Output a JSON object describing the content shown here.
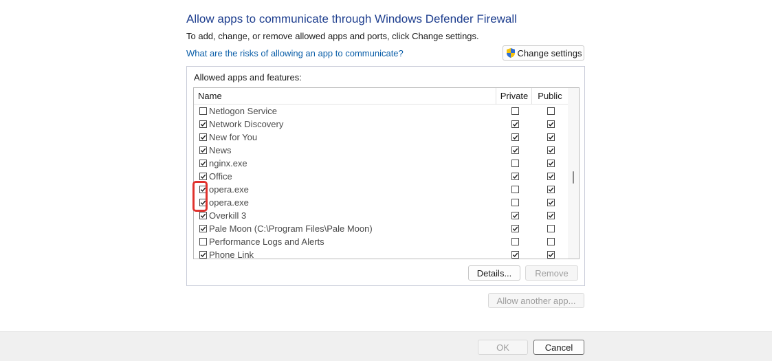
{
  "dialog": {
    "title": "Allow apps to communicate through Windows Defender Firewall",
    "subtitle": "To add, change, or remove allowed apps and ports, click Change settings.",
    "risk_link": "What are the risks of allowing an app to communicate?",
    "change_settings_label": "Change settings",
    "shield_icon": "uac-shield-icon"
  },
  "apps": {
    "group_label": "Allowed apps and features:",
    "columns": {
      "name": "Name",
      "private": "Private",
      "public": "Public"
    },
    "rows": [
      {
        "name": "Netlogon Service",
        "enabled": false,
        "private": false,
        "public": false
      },
      {
        "name": "Network Discovery",
        "enabled": true,
        "private": true,
        "public": true
      },
      {
        "name": "New for You",
        "enabled": true,
        "private": true,
        "public": true
      },
      {
        "name": "News",
        "enabled": true,
        "private": true,
        "public": true
      },
      {
        "name": "nginx.exe",
        "enabled": true,
        "private": false,
        "public": true
      },
      {
        "name": "Office",
        "enabled": true,
        "private": true,
        "public": true
      },
      {
        "name": "opera.exe",
        "enabled": true,
        "private": false,
        "public": true
      },
      {
        "name": "opera.exe",
        "enabled": true,
        "private": false,
        "public": true
      },
      {
        "name": "Overkill 3",
        "enabled": true,
        "private": true,
        "public": true
      },
      {
        "name": "Pale Moon (C:\\Program Files\\Pale Moon)",
        "enabled": true,
        "private": true,
        "public": false
      },
      {
        "name": "Performance Logs and Alerts",
        "enabled": false,
        "private": false,
        "public": false
      },
      {
        "name": "Phone Link",
        "enabled": true,
        "private": true,
        "public": true
      }
    ],
    "details_label": "Details...",
    "remove_label": "Remove",
    "allow_another_label": "Allow another app..."
  },
  "footer": {
    "ok_label": "OK",
    "cancel_label": "Cancel"
  },
  "colors": {
    "title": "#1f3f8f",
    "link": "#0a5ea8",
    "highlight": "#e0322d"
  }
}
